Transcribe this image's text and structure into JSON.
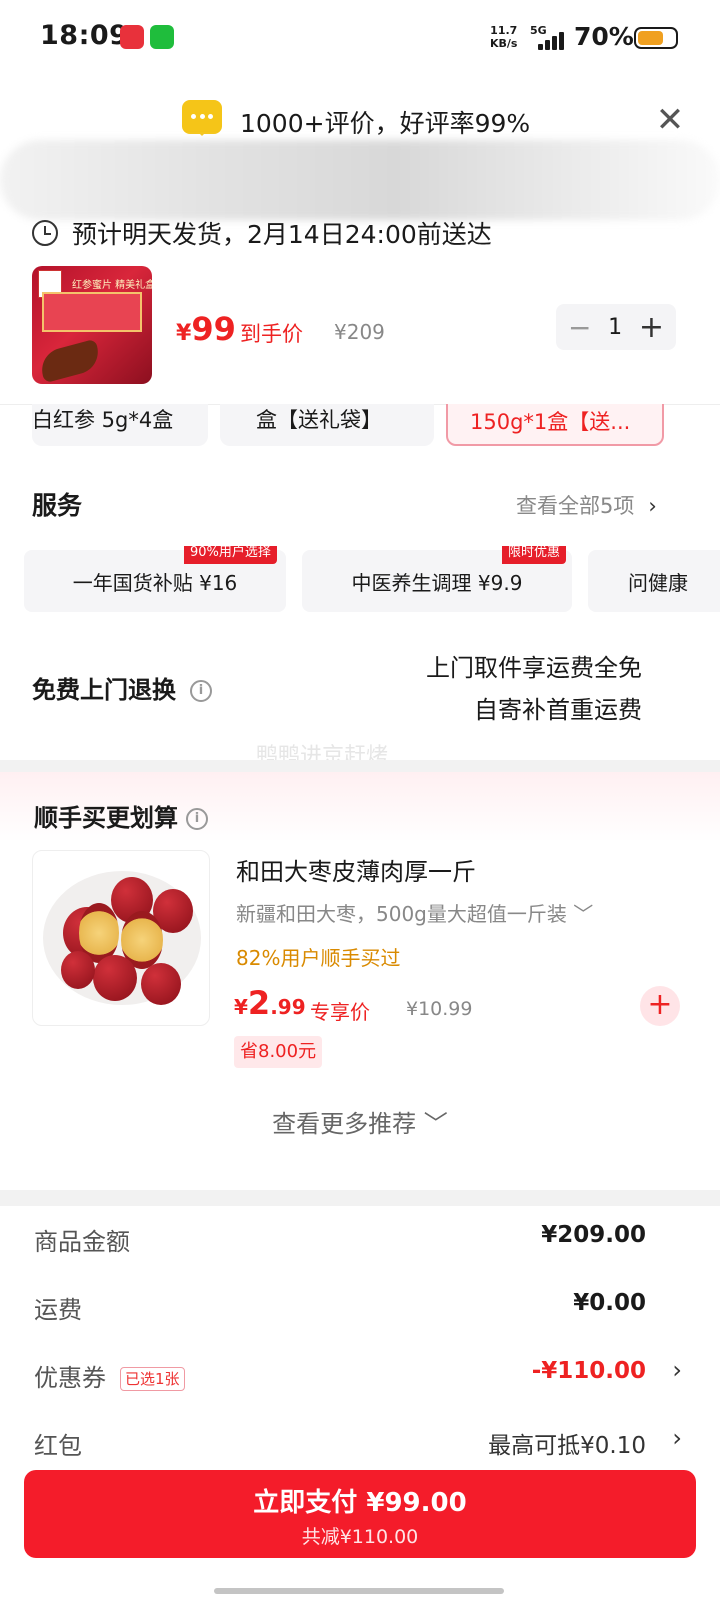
{
  "status_bar": {
    "time": "18:09",
    "net_speed_value": "11.7",
    "net_speed_unit": "KB/s",
    "network": "5G",
    "battery": "70%"
  },
  "review_banner": {
    "text": "1000+评价，好评率99%",
    "close": "✕"
  },
  "delivery": {
    "text": "预计明天发货，2月14日24:00前送达"
  },
  "product": {
    "thumb_text": "红参蜜片 精美礼盒",
    "price_currency": "¥",
    "price": "99",
    "price_label": "到手价",
    "original_price": "¥209",
    "quantity": "1",
    "minus": "−",
    "plus": "+"
  },
  "specs": [
    {
      "label": "白红参 5g*4盒"
    },
    {
      "label": "盒【送礼袋】"
    },
    {
      "label": "150g*1盒【送..."
    }
  ],
  "services": {
    "title": "服务",
    "view_all": "查看全部5项",
    "chevron": "›",
    "items": [
      {
        "label": "一年国货补贴  ¥16",
        "tag": "90%用户选择"
      },
      {
        "label": "中医养生调理  ¥9.9",
        "tag": "限时优惠"
      },
      {
        "label": "问健康",
        "tag": ""
      }
    ]
  },
  "return_service": {
    "title": "免费上门退换",
    "info": "i",
    "line1": "上门取件享运费全免",
    "line2": "自寄补首重运费"
  },
  "watermark": "鸭鸭进京赶烤",
  "bundle": {
    "title": "顺手买更划算",
    "name": "和田大枣皮薄肉厚一斤",
    "desc": "新疆和田大枣，500g量大超值一斤装 ﹀",
    "hint": "82%用户顺手买过",
    "price_currency": "¥",
    "price_int": "2",
    "price_dec": ".99",
    "price_label": "专享价",
    "original_price": "¥10.99",
    "save": "省8.00元",
    "add": "+",
    "more": "查看更多推荐 ﹀"
  },
  "summary": {
    "goods_label": "商品金额",
    "goods_value": "¥209.00",
    "shipping_label": "运费",
    "shipping_value": "¥0.00",
    "coupon_label": "优惠券",
    "coupon_chip": "已选1张",
    "coupon_value": "-¥110.00",
    "redpacket_label": "红包",
    "redpacket_value": "最高可抵¥0.10",
    "chevron": "›"
  },
  "pay": {
    "main": "立即支付 ¥99.00",
    "sub": "共减¥110.00"
  },
  "colors": {
    "accent_red": "#f41c2a",
    "price_red": "#e22222",
    "hint_orange": "#d98a00"
  }
}
